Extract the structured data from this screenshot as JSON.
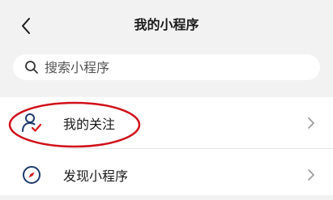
{
  "header": {
    "title": "我的小程序",
    "back_icon": "chevron-left-icon"
  },
  "search": {
    "placeholder": "搜索小程序",
    "icon": "search-icon"
  },
  "list": {
    "items": [
      {
        "label": "我的关注",
        "icon": "user-check-icon",
        "highlighted": true
      },
      {
        "label": "发现小程序",
        "icon": "compass-icon",
        "highlighted": false
      }
    ]
  },
  "colors": {
    "background": "#f2f2f2",
    "accent_red": "#d71920",
    "icon_navy": "#1f3a6b",
    "annotation_red": "#d0101a"
  }
}
